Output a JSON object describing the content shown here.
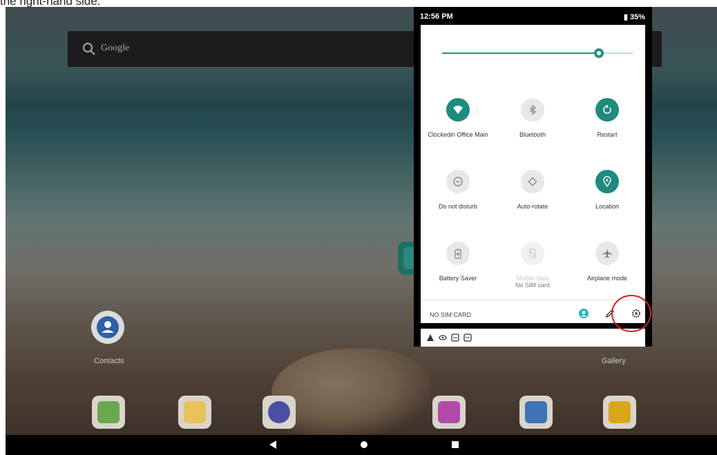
{
  "caption": "the right-hand side.",
  "status_bar": {
    "time": "12:56 PM",
    "battery": "35%"
  },
  "search": {
    "placeholder": "Google"
  },
  "quick_settings": {
    "tiles": [
      {
        "label": "Clockedin Office Main",
        "icon": "wifi-icon",
        "on": true
      },
      {
        "label": "Bluetooth",
        "icon": "bluetooth-icon",
        "on": false
      },
      {
        "label": "Restart",
        "icon": "restart-icon",
        "on": true
      },
      {
        "label": "Do not disturb",
        "icon": "dnd-icon",
        "on": false
      },
      {
        "label": "Auto-rotate",
        "icon": "rotate-icon",
        "on": false
      },
      {
        "label": "Location",
        "icon": "location-icon",
        "on": true
      },
      {
        "label": "Battery Saver",
        "icon": "battery-saver-icon",
        "on": false
      },
      {
        "label": "Mobile data",
        "sublabel": "No SIM card",
        "icon": "mobile-data-icon",
        "on": false,
        "disabled": true
      },
      {
        "label": "Airplane mode",
        "icon": "airplane-icon",
        "on": false
      }
    ],
    "footer_text": "NO SIM CARD"
  },
  "home_labels": {
    "contacts": "Contacts",
    "gallery": "Gallery"
  },
  "colors": {
    "accent": "#1f8a7e",
    "highlight": "#d32222"
  }
}
